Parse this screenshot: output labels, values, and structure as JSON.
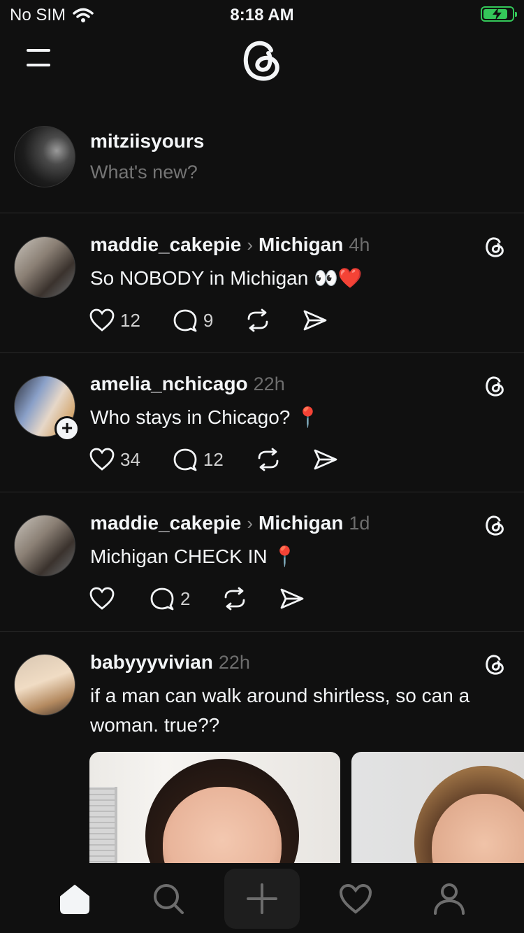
{
  "status_bar": {
    "carrier": "No SIM",
    "time": "8:18 AM",
    "battery_level": 0.85
  },
  "header": {
    "menu_icon": "hamburger-menu-icon",
    "logo_icon": "threads-logo-icon"
  },
  "composer": {
    "username": "mitziisyours",
    "placeholder": "What's new?"
  },
  "posts": [
    {
      "username": "maddie_cakepie",
      "separator": "›",
      "community": "Michigan",
      "time": "4h",
      "text": "So NOBODY in Michigan 👀❤️",
      "likes": "12",
      "replies": "9"
    },
    {
      "username": "amelia_nchicago",
      "time": "22h",
      "text": "Who stays in Chicago? 📍",
      "likes": "34",
      "replies": "12",
      "follow_badge": "+"
    },
    {
      "username": "maddie_cakepie",
      "separator": "›",
      "community": "Michigan",
      "time": "1d",
      "text": "Michigan CHECK IN 📍",
      "likes": "",
      "replies": "2"
    },
    {
      "username": "babyyyvivian",
      "time": "22h",
      "text": "if a man can walk around shirtless, so can a woman. true??"
    }
  ],
  "tabbar": {
    "items": [
      "home-icon",
      "search-icon",
      "compose-icon",
      "activity-heart-icon",
      "profile-icon"
    ],
    "active": "home-icon"
  },
  "colors": {
    "background": "#101010",
    "text": "#f3f5f7",
    "muted": "#6d6d6d",
    "battery": "#34c759"
  }
}
